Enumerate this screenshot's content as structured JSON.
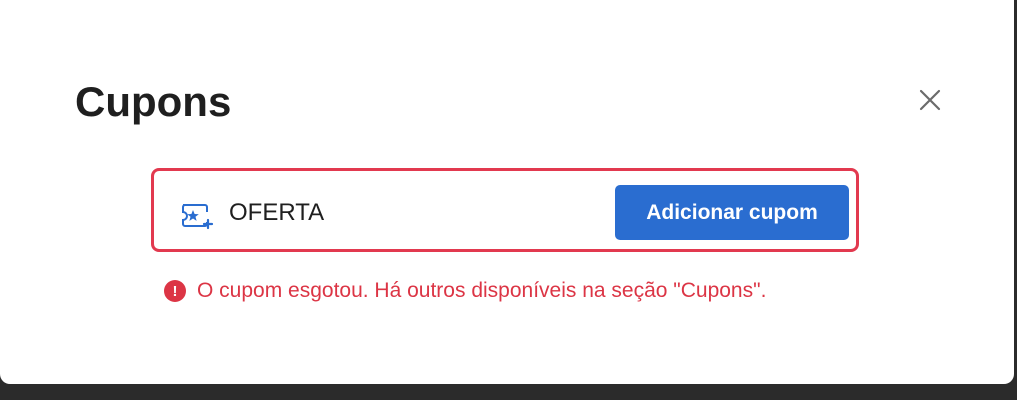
{
  "modal": {
    "title": "Cupons",
    "close_icon": "close-icon"
  },
  "coupon": {
    "icon": "coupon-ticket-icon",
    "value": "OFERTA",
    "button_label": "Adicionar cupom"
  },
  "error": {
    "icon": "exclamation-circle-icon",
    "message": "O cupom esgotou. Há outros disponíveis na seção \"Cupons\"."
  },
  "colors": {
    "accent": "#2a6dd0",
    "error": "#dc3545",
    "title_text": "#1f1f1f"
  }
}
